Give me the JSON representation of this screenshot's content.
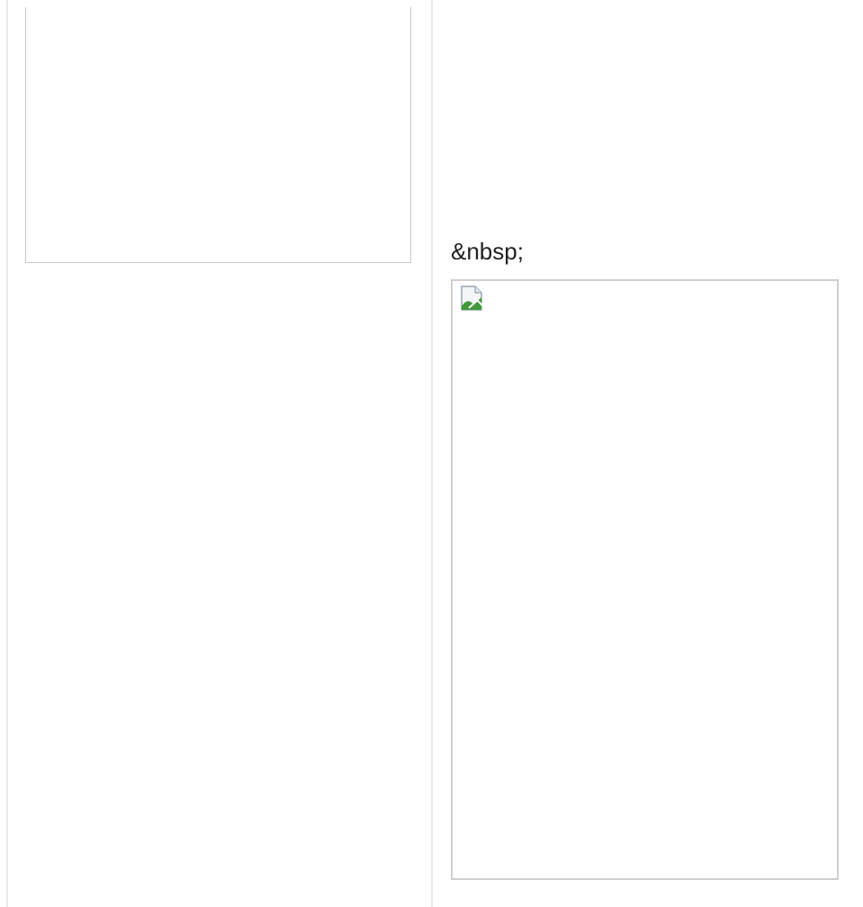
{
  "content": {
    "entity_text": "&nbsp;"
  },
  "icons": {
    "broken_image": "broken-image-icon"
  },
  "colors": {
    "rule": "#e9e9e9",
    "frame_border": "#cfcfcf",
    "text": "#222222",
    "image_green": "#3f9a3a"
  }
}
